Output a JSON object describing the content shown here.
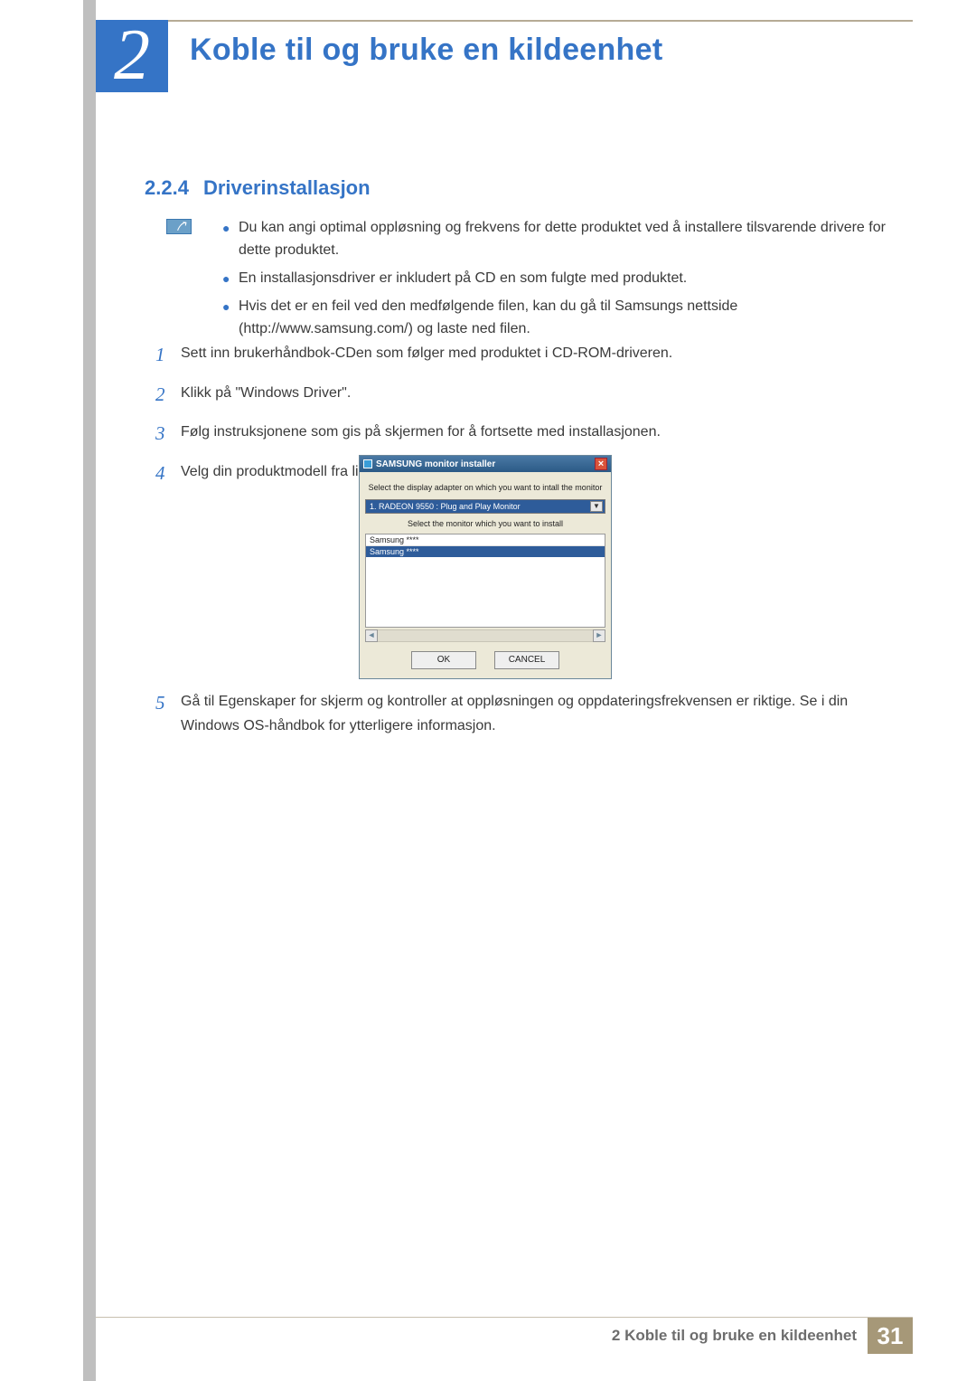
{
  "chapter": {
    "number": "2",
    "title": "Koble til og bruke en kildeenhet"
  },
  "section": {
    "number": "2.2.4",
    "title": "Driverinstallasjon"
  },
  "info_bullets": [
    "Du kan angi optimal oppløsning og frekvens for dette produktet ved å installere tilsvarende drivere for dette produktet.",
    "En installasjonsdriver er inkludert på CD en som fulgte med produktet.",
    "Hvis det er en feil ved den medfølgende filen, kan du gå til Samsungs nettside (http://www.samsung.com/) og laste ned filen."
  ],
  "steps_upper": [
    {
      "n": "1",
      "t": "Sett inn brukerhåndbok-CDen som følger med produktet i CD-ROM-driveren."
    },
    {
      "n": "2",
      "t": "Klikk på \"Windows Driver\"."
    },
    {
      "n": "3",
      "t": "Følg instruksjonene som gis på skjermen for å fortsette med installasjonen."
    },
    {
      "n": "4",
      "t": "Velg din produktmodell fra listen over modeller."
    }
  ],
  "steps_lower": [
    {
      "n": "5",
      "t": "Gå til Egenskaper for skjerm og kontroller at oppløsningen og oppdateringsfrekvensen er riktige. Se i din Windows OS-håndbok for ytterligere informasjon."
    }
  ],
  "installer": {
    "title": "SAMSUNG monitor installer",
    "label1": "Select the display adapter on which you want to intall the monitor",
    "select_value": "1. RADEON 9550 : Plug and Play Monitor",
    "label2": "Select the monitor which you want to install",
    "list": {
      "item0": "Samsung ****",
      "item1": "Samsung ****"
    },
    "ok": "OK",
    "cancel": "CANCEL"
  },
  "footer": {
    "text": "2 Koble til og bruke en kildeenhet",
    "page": "31"
  }
}
